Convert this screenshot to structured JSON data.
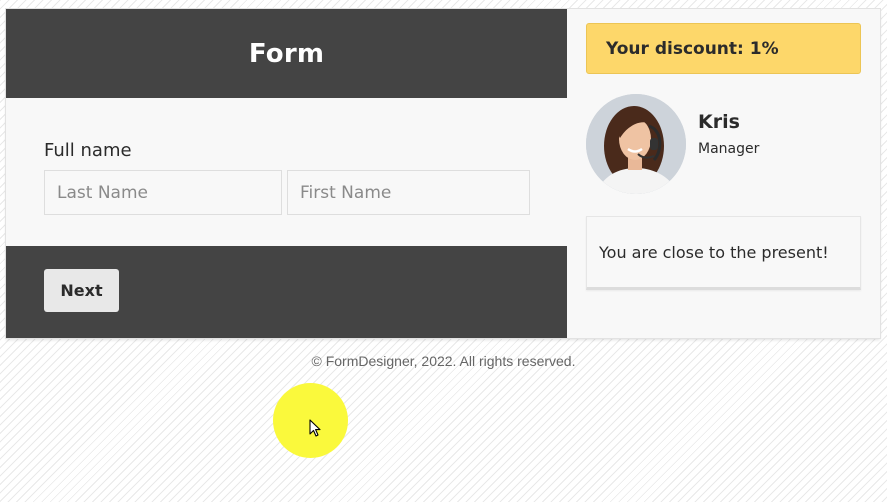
{
  "form": {
    "title": "Form",
    "full_name_label": "Full name",
    "last_name": {
      "value": "",
      "placeholder": "Last Name"
    },
    "first_name": {
      "value": "",
      "placeholder": "First Name"
    },
    "next_label": "Next"
  },
  "sidebar": {
    "discount_text": "Your discount: 1%",
    "manager": {
      "name": "Kris",
      "role": "Manager"
    },
    "message": "You are close to the present!"
  },
  "footer": {
    "copyright": "© FormDesigner, 2022. All rights reserved."
  },
  "colors": {
    "header_bg": "#444444",
    "discount_bg": "#fdd76a",
    "cursor_highlight": "#faf93c"
  }
}
